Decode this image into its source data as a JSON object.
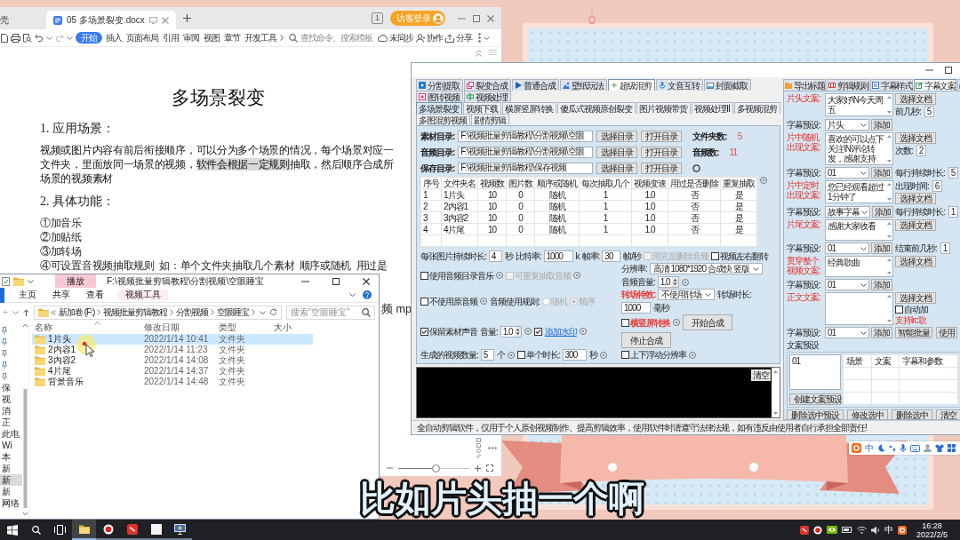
{
  "caption": "比如片头抽一个啊",
  "wps": {
    "tabs": [
      {
        "label": "壳",
        "selected": false
      },
      {
        "label": "05 多场景裂变.docx",
        "selected": true
      }
    ],
    "window_count": "1",
    "login_button": "访客登录",
    "ribbon": [
      {
        "label": "开始",
        "selected": true
      },
      {
        "label": "插入",
        "selected": false
      },
      {
        "label": "页面布局",
        "selected": false
      },
      {
        "label": "引用",
        "selected": false
      },
      {
        "label": "审阅",
        "selected": false
      },
      {
        "label": "视图",
        "selected": false
      },
      {
        "label": "章节",
        "selected": false
      },
      {
        "label": "开发工具",
        "selected": false
      }
    ],
    "search": {
      "placeholder": "查找命令、搜索模板"
    },
    "actions": [
      "未同步",
      "协作",
      "分享"
    ],
    "document": {
      "title": "多场景裂变",
      "blocks": [
        {
          "kind": "heading",
          "segments": [
            {
              "text": "1. 应用场景：",
              "highlighted": false
            }
          ]
        },
        {
          "kind": "paragraph",
          "segments": [
            {
              "text": "视频或图片内容有前后衔接顺序，可以分为多个场景的情况，每个场景对应一",
              "highlighted": false
            }
          ]
        },
        {
          "kind": "paragraph",
          "segments": [
            {
              "text": "文件夹，里面放同一场景的视频，",
              "highlighted": false
            },
            {
              "text": "软件会根据一定规则",
              "highlighted": true
            },
            {
              "text": "抽取，然后顺序合成所",
              "highlighted": false
            }
          ]
        },
        {
          "kind": "paragraph",
          "segments": [
            {
              "text": "场景的视频素材",
              "highlighted": false
            }
          ]
        },
        {
          "kind": "heading",
          "segments": [
            {
              "text": "2. 具体功能：",
              "highlighted": false
            }
          ]
        },
        {
          "kind": "item",
          "segments": [
            {
              "text": "①加音乐",
              "highlighted": false
            }
          ]
        },
        {
          "kind": "item",
          "segments": [
            {
              "text": "②加贴纸",
              "highlighted": false
            }
          ]
        },
        {
          "kind": "item",
          "segments": [
            {
              "text": "③加转场",
              "highlighted": false
            }
          ]
        },
        {
          "kind": "item",
          "segments": [
            {
              "text": "④可设置音视频抽取规则  如：单个文件夹抽取几个素材  顺序或随机  用过是",
              "highlighted": false
            }
          ]
        },
        {
          "kind": "tail",
          "segments": [
            {
              "text": "频 mp",
              "highlighted": false
            }
          ]
        }
      ]
    },
    "zoom": {
      "level": 0.52
    }
  },
  "explorer": {
    "context_tab": "播放",
    "title": "F:\\视频批量剪辑教程\\分割视频\\空眼睡宝",
    "ribbon": [
      {
        "label": "主页",
        "kind": "standard",
        "selected": false
      },
      {
        "label": "共享",
        "kind": "standard",
        "selected": false
      },
      {
        "label": "查看",
        "kind": "standard",
        "selected": false
      },
      {
        "label": "视频工具",
        "kind": "contextual",
        "selected": false
      }
    ],
    "breadcrumb": [
      "新加卷 (F:)",
      "视频批量剪辑教程",
      "分割视频",
      "空眼睡宝"
    ],
    "search": {
      "placeholder": "搜索“空眼睡宝”"
    },
    "nav": [
      {
        "kind": "pinned"
      },
      {
        "kind": "pinned"
      },
      {
        "kind": "pinned"
      },
      {
        "kind": "pinned"
      },
      {
        "kind": "pinned"
      },
      {
        "kind": "entry",
        "label": "保",
        "selected": false
      },
      {
        "kind": "entry",
        "label": "视",
        "selected": false
      },
      {
        "kind": "entry",
        "label": "消",
        "selected": false
      },
      {
        "kind": "entry",
        "label": "正",
        "selected": false
      },
      {
        "kind": "entry",
        "label": "此电",
        "selected": false
      },
      {
        "kind": "entry",
        "label": "Wi",
        "selected": false
      },
      {
        "kind": "entry",
        "label": "本",
        "selected": false
      },
      {
        "kind": "entry",
        "label": "新",
        "selected": false
      },
      {
        "kind": "entry",
        "label": "新",
        "selected": true
      },
      {
        "kind": "entry",
        "label": "新",
        "selected": false
      },
      {
        "kind": "entry",
        "label": "网络",
        "selected": false
      }
    ],
    "columns": [
      "名称",
      "修改日期",
      "类型",
      "大小"
    ],
    "rows": [
      {
        "name": "1片头",
        "modified": "2022/1/14 10:41",
        "type": "文件夹",
        "selected": true
      },
      {
        "name": "2内容1",
        "modified": "2022/1/14 11:23",
        "type": "文件夹",
        "selected": false
      },
      {
        "name": "3内容2",
        "modified": "2022/1/14 14:08",
        "type": "文件夹",
        "selected": false
      },
      {
        "name": "4片尾",
        "modified": "2022/1/14 14:37",
        "type": "文件夹",
        "selected": false
      },
      {
        "name": "背景音乐",
        "modified": "2022/1/14 14:48",
        "type": "文件夹",
        "selected": false
      }
    ]
  },
  "app": {
    "main_tabs": [
      {
        "label": "分割提取",
        "selected": false
      },
      {
        "label": "裂变合成",
        "selected": false
      },
      {
        "label": "普通合成",
        "selected": false
      },
      {
        "label": "壁纸玩法",
        "selected": false
      },
      {
        "label": "超级混剪",
        "selected": true
      },
      {
        "label": "文音互转",
        "selected": false
      },
      {
        "label": "封面截取",
        "selected": false
      },
      {
        "label": "图转视频",
        "selected": false
      },
      {
        "label": "视频处理",
        "selected": false
      }
    ],
    "sub_tabs": [
      {
        "label": "多场景裂变",
        "selected": true
      },
      {
        "label": "视频下载",
        "selected": false
      },
      {
        "label": "横屏竖屏转换",
        "selected": false
      },
      {
        "label": "傻瓜式视频原创裂变",
        "selected": false
      },
      {
        "label": "图片视频带货",
        "selected": false
      },
      {
        "label": "视频处理Ⅱ",
        "selected": false
      },
      {
        "label": "多视频混剪",
        "selected": false
      },
      {
        "label": "多图混剪视频",
        "selected": false
      },
      {
        "label": "剧情剪辑",
        "selected": false
      }
    ],
    "directories": [
      {
        "kind": "counted",
        "label": "素材目录:",
        "value": "F:\\视频批量剪辑教程\\分割视频\\空眼",
        "buttons": [
          "选择目录",
          "打开目录"
        ],
        "stat_label": "文件夹数:",
        "stat": "5"
      },
      {
        "kind": "counted",
        "label": "音频目录:",
        "value": "F:\\视频批量剪辑教程\\分割视频\\空眼",
        "buttons": [
          "选择目录",
          "打开目录"
        ],
        "stat_label": "音频数:",
        "stat": "11"
      },
      {
        "kind": "output",
        "label": "保存目录:",
        "value": "F:\\视频批量剪辑教程\\保存视频",
        "buttons": [
          "选择目录",
          "打开目录"
        ]
      }
    ],
    "table": {
      "columns": [
        "序号",
        "文件夹名",
        "视频数",
        "图片数",
        "顺序或随机",
        "每次抽取几个",
        "视频变速",
        "用过是否删除",
        "重复抽取"
      ],
      "rows": [
        [
          "1",
          "1片头",
          "10",
          "0",
          "随机",
          "1",
          "1.0",
          "否",
          "是"
        ],
        [
          "2",
          "2内容1",
          "10",
          "0",
          "随机",
          "1",
          "1.0",
          "否",
          "是"
        ],
        [
          "3",
          "3内容2",
          "10",
          "0",
          "随机",
          "1",
          "1.0",
          "否",
          "是"
        ],
        [
          "4",
          "4片尾",
          "10",
          "0",
          "随机",
          "1",
          "1.0",
          "否",
          "是"
        ]
      ]
    },
    "settings": [
      {
        "left": [
          {
            "kind": "text",
            "text": "每张图片持续时长:"
          },
          {
            "kind": "input",
            "value": "4"
          },
          {
            "kind": "text",
            "text": "秒"
          },
          {
            "kind": "text",
            "text": "比特率:"
          },
          {
            "kind": "input",
            "value": "1000"
          },
          {
            "kind": "text",
            "text": "k"
          },
          {
            "kind": "text",
            "text": "帧率:"
          },
          {
            "kind": "input",
            "value": "30"
          },
          {
            "kind": "text",
            "text": "帧/秒"
          },
          {
            "kind": "check",
            "label": "用完后删除音频",
            "checked": false,
            "disabled": true
          },
          {
            "kind": "check",
            "label": "视频左右翻转",
            "checked": false,
            "disabled": false
          }
        ]
      },
      {
        "left": [
          {
            "kind": "check",
            "label": "使用音频目录音乐",
            "checked": false,
            "disabled": false
          },
          {
            "kind": "help"
          },
          {
            "kind": "check",
            "label": "可重复抽取音频",
            "checked": false,
            "disabled": true
          },
          {
            "kind": "help"
          }
        ],
        "right": [
          {
            "kind": "text",
            "text": "分辨率:"
          },
          {
            "kind": "select",
            "value": "高清 1080*1920 合成快 竖版"
          },
          {
            "kind": "text",
            "text": "音频音量:"
          },
          {
            "kind": "spin",
            "value": "1.0"
          },
          {
            "kind": "help"
          }
        ]
      },
      {
        "left": [
          {
            "kind": "check",
            "label": "不使用原音频",
            "checked": false,
            "disabled": false
          },
          {
            "kind": "help"
          },
          {
            "kind": "text",
            "text": "音频使用规则:"
          },
          {
            "kind": "radio",
            "label": "随机",
            "selected": false,
            "disabled": true
          },
          {
            "kind": "radio",
            "label": "顺序",
            "selected": true,
            "disabled": true
          }
        ],
        "right": [
          {
            "kind": "text",
            "text": "转场特效:",
            "color": "#e8413c"
          },
          {
            "kind": "select",
            "value": "不使用转场"
          },
          {
            "kind": "text",
            "text": "转场时长:"
          },
          {
            "kind": "input",
            "value": "1000"
          },
          {
            "kind": "text",
            "text": "毫秒"
          }
        ]
      },
      {
        "left": [
          {
            "kind": "check",
            "label": "保留素材声音",
            "checked": true,
            "disabled": false
          },
          {
            "kind": "text",
            "text": "音量:"
          },
          {
            "kind": "spin",
            "value": "1.0"
          },
          {
            "kind": "help"
          },
          {
            "kind": "check",
            "checked": true,
            "disabled": false
          },
          {
            "kind": "link",
            "text": "添加水印"
          },
          {
            "kind": "help"
          }
        ],
        "right": [
          {
            "kind": "check",
            "label": "横竖屏转换",
            "checked": false,
            "disabled": false,
            "color": "#e8413c"
          },
          {
            "kind": "help"
          },
          {
            "kind": "button",
            "label": "开始合成"
          },
          {
            "kind": "button",
            "label": "停止合成"
          }
        ]
      },
      {
        "left": [
          {
            "kind": "text",
            "text": "生成的视频数量:"
          },
          {
            "kind": "input",
            "value": "5"
          },
          {
            "kind": "text",
            "text": "个"
          },
          {
            "kind": "help"
          },
          {
            "kind": "check",
            "label": "单个时长:",
            "checked": false,
            "disabled": false
          },
          {
            "kind": "input",
            "value": "300"
          },
          {
            "kind": "text",
            "text": "秒"
          },
          {
            "kind": "help"
          }
        ],
        "right": [
          {
            "kind": "check",
            "label": "上下浮动分辨率",
            "checked": false,
            "disabled": false
          },
          {
            "kind": "help"
          }
        ]
      }
    ],
    "log": {
      "clear_button": "清空"
    },
    "status": "全自动剪辑软件，仅用于个人原创视频制作、提高剪辑效率，使用软件时请遵守法律法规，如有违反由使用者自行承担全部责任!"
  },
  "subtitle_panel": {
    "tabs": [
      {
        "label": "导出标题",
        "selected": false
      },
      {
        "label": "剪辑规则",
        "selected": false
      },
      {
        "label": "字幕样式",
        "selected": false
      },
      {
        "label": "字幕文案",
        "selected": true
      },
      {
        "selected": false
      }
    ],
    "blocks": [
      {
        "kind": "short",
        "label": "片头文案:",
        "text": "大家好\\N今天周五",
        "side": [
          {
            "kind": "button",
            "label": "选择文档"
          },
          {
            "kind": "field",
            "label": "前几秒:",
            "value": "5"
          }
        ],
        "preset": {
          "label": "字幕预设:",
          "value": "片头",
          "button": "添加"
        }
      },
      {
        "kind": "short",
        "label": "片中随机出现文案:",
        "text": "喜欢的可以点下关注\\N评论转发，感谢支持",
        "side": [
          {
            "kind": "button",
            "label": "选择文档"
          },
          {
            "kind": "field",
            "label": "次数:",
            "value": "2"
          }
        ],
        "preset": {
          "label": "字幕预设:",
          "value": "01",
          "button": "添加",
          "extra": {
            "label": "每行持续时长:",
            "value": "5"
          }
        }
      },
      {
        "kind": "short",
        "label": "片中定时出现文案:",
        "text": "您已经观看超过1分钟了",
        "side": [
          {
            "kind": "field",
            "label": "出现时间:",
            "value": "6"
          },
          {
            "kind": "button",
            "label": "选择文档"
          }
        ],
        "preset": {
          "label": "字幕预设:",
          "value": "故事字幕",
          "button": "添加",
          "extra": {
            "label": "每行持续时长:",
            "value": "1"
          }
        }
      },
      {
        "kind": "short",
        "label": "片尾文案:",
        "text": "感谢大家收看",
        "side": [
          {
            "kind": "button",
            "label": "选择文档"
          }
        ],
        "preset": {
          "label": "字幕预设:",
          "value": "01",
          "button": "添加",
          "extra": {
            "label": "结束前几秒:",
            "value": "1"
          }
        }
      },
      {
        "kind": "short",
        "label": "贯穿整个视频文案:",
        "text": "经典歌曲",
        "side": [
          {
            "kind": "button",
            "label": "选择文档"
          }
        ],
        "preset": {
          "label": "字幕预设:",
          "value": "01",
          "button": "添加"
        }
      },
      {
        "kind": "long",
        "label": "正文文案:",
        "side": [
          {
            "kind": "button",
            "label": "选择文档"
          },
          {
            "kind": "check",
            "label": "自动加",
            "checked": false
          },
          {
            "kind": "note",
            "text": "支持lrc歌"
          }
        ],
        "preset": {
          "label": "字幕预设:",
          "value": "01",
          "button": "添加",
          "more": [
            "智能批量",
            "使用"
          ]
        }
      }
    ],
    "presets": {
      "title": "文案预设",
      "list": [
        "01"
      ],
      "columns": [
        "场景",
        "文案",
        "字幕和参数"
      ],
      "create_button": "创建文案预设",
      "buttons": [
        "删除选中预设",
        "修改选中",
        "删除选中",
        "清空"
      ]
    }
  },
  "ime_bar": {
    "mode": "中"
  },
  "taskbar": {
    "apps": [
      {
        "active": true
      },
      {
        "active": false
      },
      {
        "active": false
      },
      {
        "active": false
      },
      {
        "active": false
      }
    ],
    "input_mode": "中",
    "time": "16:28",
    "date": "2022/2/5"
  }
}
